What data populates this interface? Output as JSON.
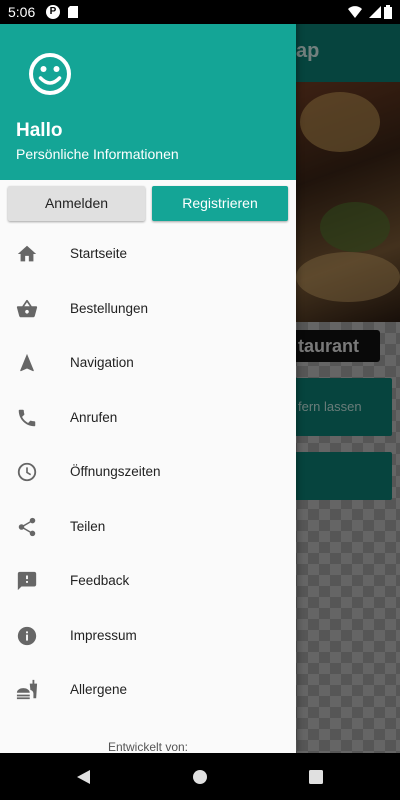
{
  "status_bar": {
    "time": "5:06",
    "icons": [
      "p-badge-icon",
      "sd-card-icon",
      "wifi-icon",
      "signal-icon",
      "battery-icon"
    ]
  },
  "background_app": {
    "title_partial": "ap",
    "tag_partial": "taurant",
    "button_partial": "fern lassen"
  },
  "drawer": {
    "header": {
      "avatar_icon": "smiley-face-icon",
      "greeting": "Hallo",
      "subtitle": "Persönliche Informationen"
    },
    "buttons": {
      "login": "Anmelden",
      "register": "Registrieren"
    },
    "menu": [
      {
        "label": "Startseite",
        "icon": "home-icon"
      },
      {
        "label": "Bestellungen",
        "icon": "basket-icon"
      },
      {
        "label": "Navigation",
        "icon": "navigation-arrow-icon"
      },
      {
        "label": "Anrufen",
        "icon": "phone-icon"
      },
      {
        "label": "Öffnungszeiten",
        "icon": "clock-icon"
      },
      {
        "label": "Teilen",
        "icon": "share-icon"
      },
      {
        "label": "Feedback",
        "icon": "feedback-icon"
      },
      {
        "label": "Impressum",
        "icon": "info-icon"
      },
      {
        "label": "Allergene",
        "icon": "fastfood-icon"
      }
    ],
    "footer": "Entwickelt von:"
  },
  "colors": {
    "accent": "#14a596",
    "toolbar_dark": "#0b7d72"
  }
}
